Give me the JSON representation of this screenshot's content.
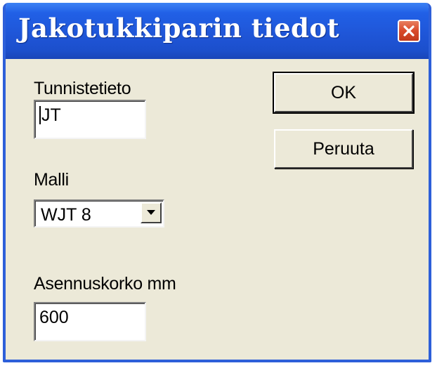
{
  "window": {
    "title": "Jakotukkiparin tiedot",
    "close_icon": "close-icon"
  },
  "fields": {
    "identifier": {
      "label": "Tunnistetieto",
      "value": "JT"
    },
    "model": {
      "label": "Malli",
      "selected": "WJT 8",
      "arrow_icon": "chevron-down-icon"
    },
    "height": {
      "label": "Asennuskorko mm",
      "value": "600"
    }
  },
  "buttons": {
    "ok": "OK",
    "cancel": "Peruuta"
  },
  "colors": {
    "titlebar": "#1f56d8",
    "dialog_bg": "#ece9d8",
    "close_button": "#d94a2a"
  }
}
